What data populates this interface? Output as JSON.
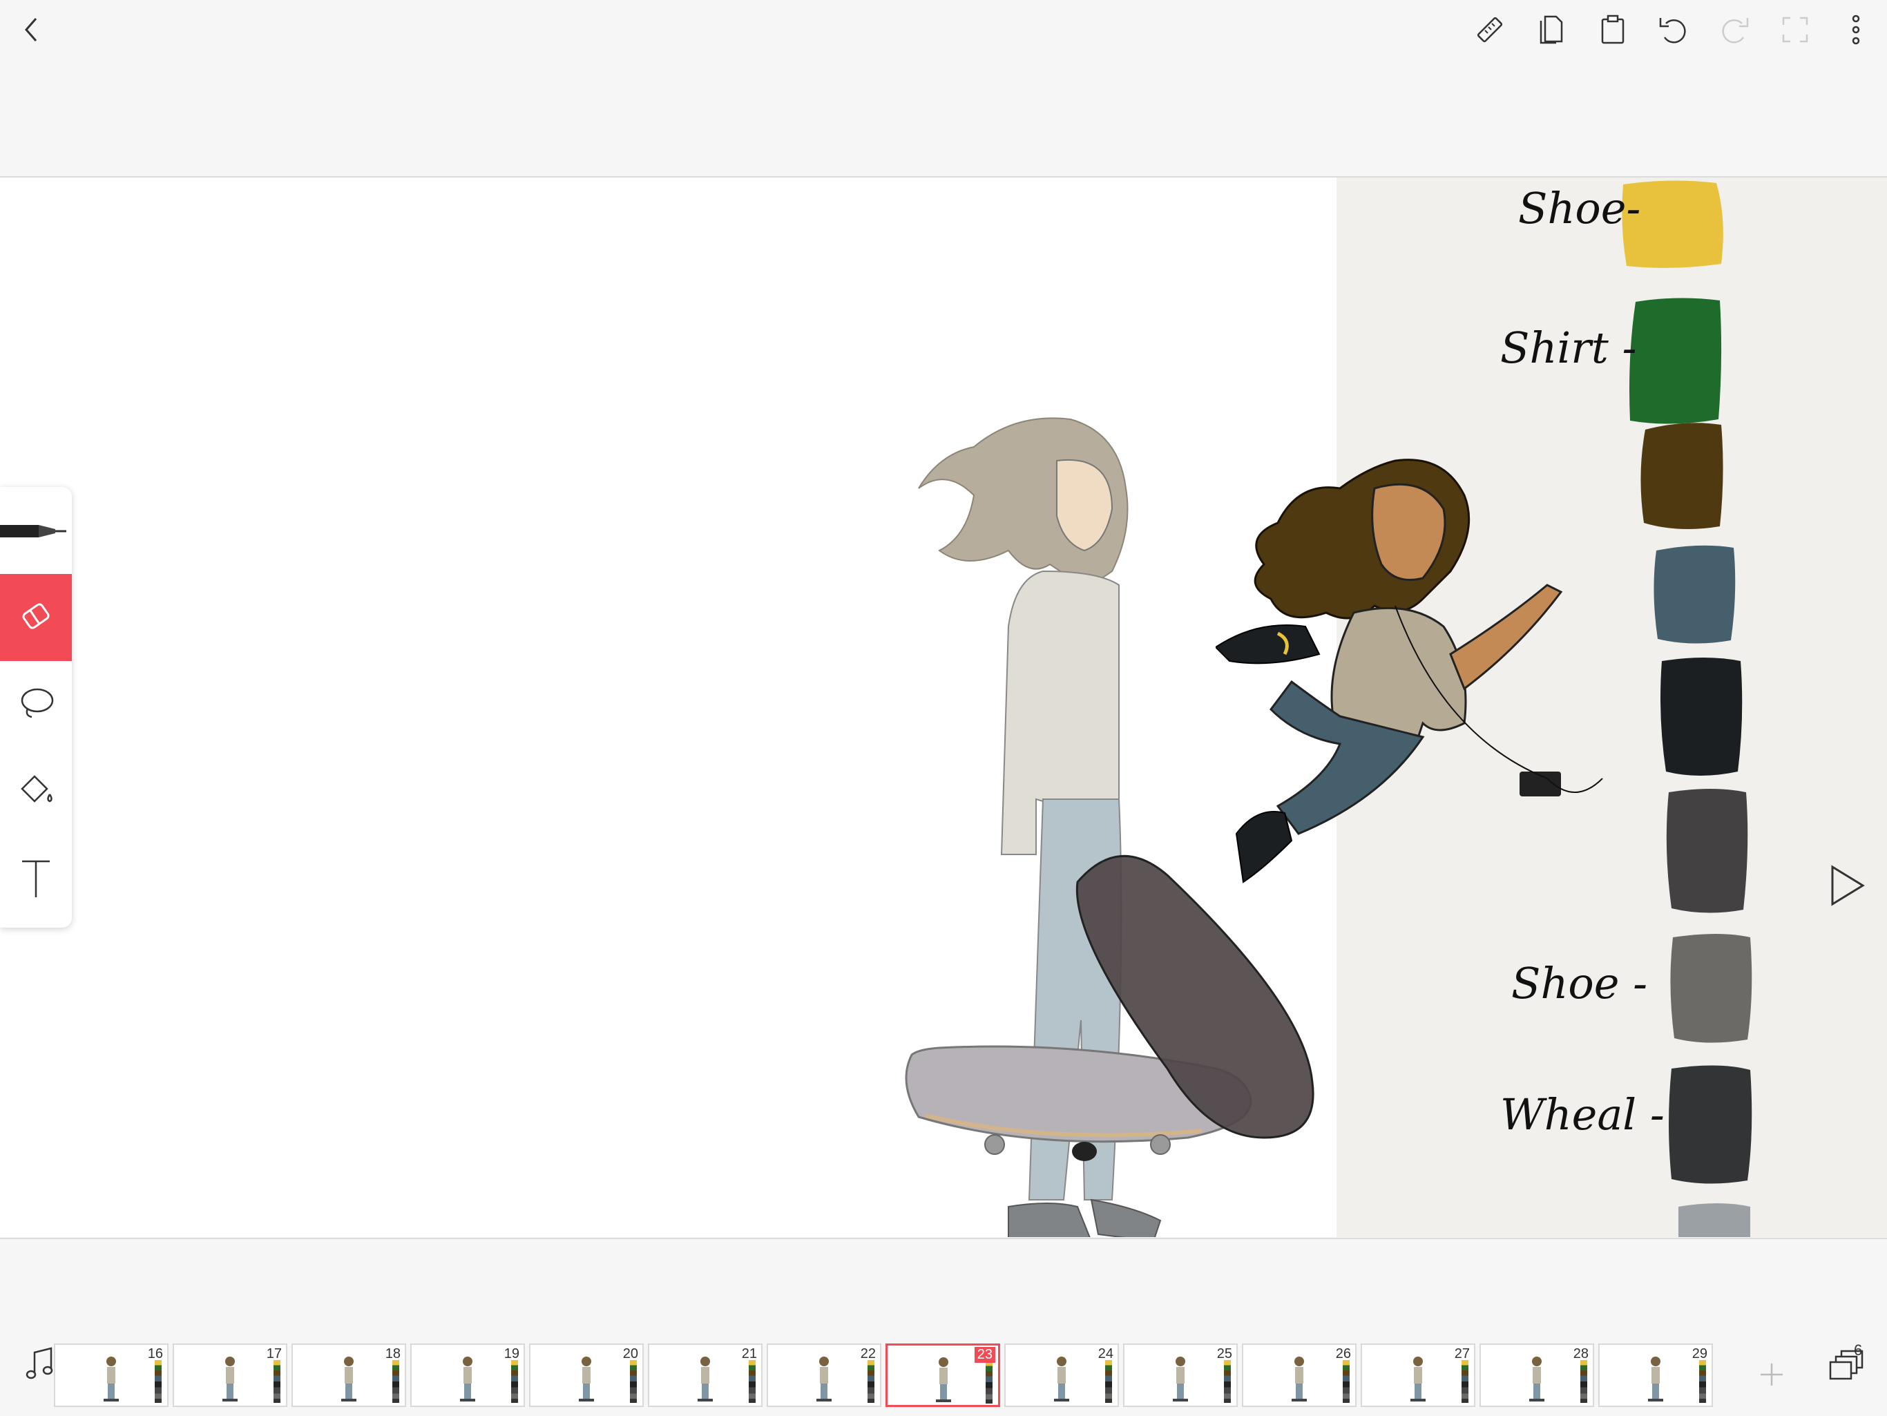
{
  "toolbar": {
    "back_icon": "chevron-left-icon",
    "right_icons": [
      "ruler-icon",
      "copy-icon",
      "paste-icon",
      "undo-icon",
      "redo-icon",
      "fullscreen-icon",
      "more-icon"
    ]
  },
  "tools": [
    {
      "name": "pen-tool",
      "icon": "pen-icon",
      "active": false
    },
    {
      "name": "eraser-tool",
      "icon": "eraser-icon",
      "active": true
    },
    {
      "name": "lasso-tool",
      "icon": "lasso-icon",
      "active": false
    },
    {
      "name": "fill-tool",
      "icon": "paint-bucket-icon",
      "active": false
    },
    {
      "name": "text-tool",
      "icon": "text-icon",
      "active": false
    }
  ],
  "palette": {
    "labels": [
      "Shoe-",
      "Shirt -",
      "Shoe -",
      "Wheal -"
    ],
    "swatches": [
      "#e8c23c",
      "#1f6b2b",
      "#4f3910",
      "#455f6c",
      "#1b1f22",
      "#444143",
      "#6b6a66",
      "#333436",
      "#9aa0a4"
    ]
  },
  "timeline": {
    "frames": [
      "16",
      "17",
      "18",
      "19",
      "20",
      "21",
      "22",
      "23",
      "24",
      "25",
      "26",
      "27",
      "28",
      "29"
    ],
    "current_frame": "23",
    "layers_count": "6"
  },
  "colors": {
    "accent": "#f24b55"
  }
}
